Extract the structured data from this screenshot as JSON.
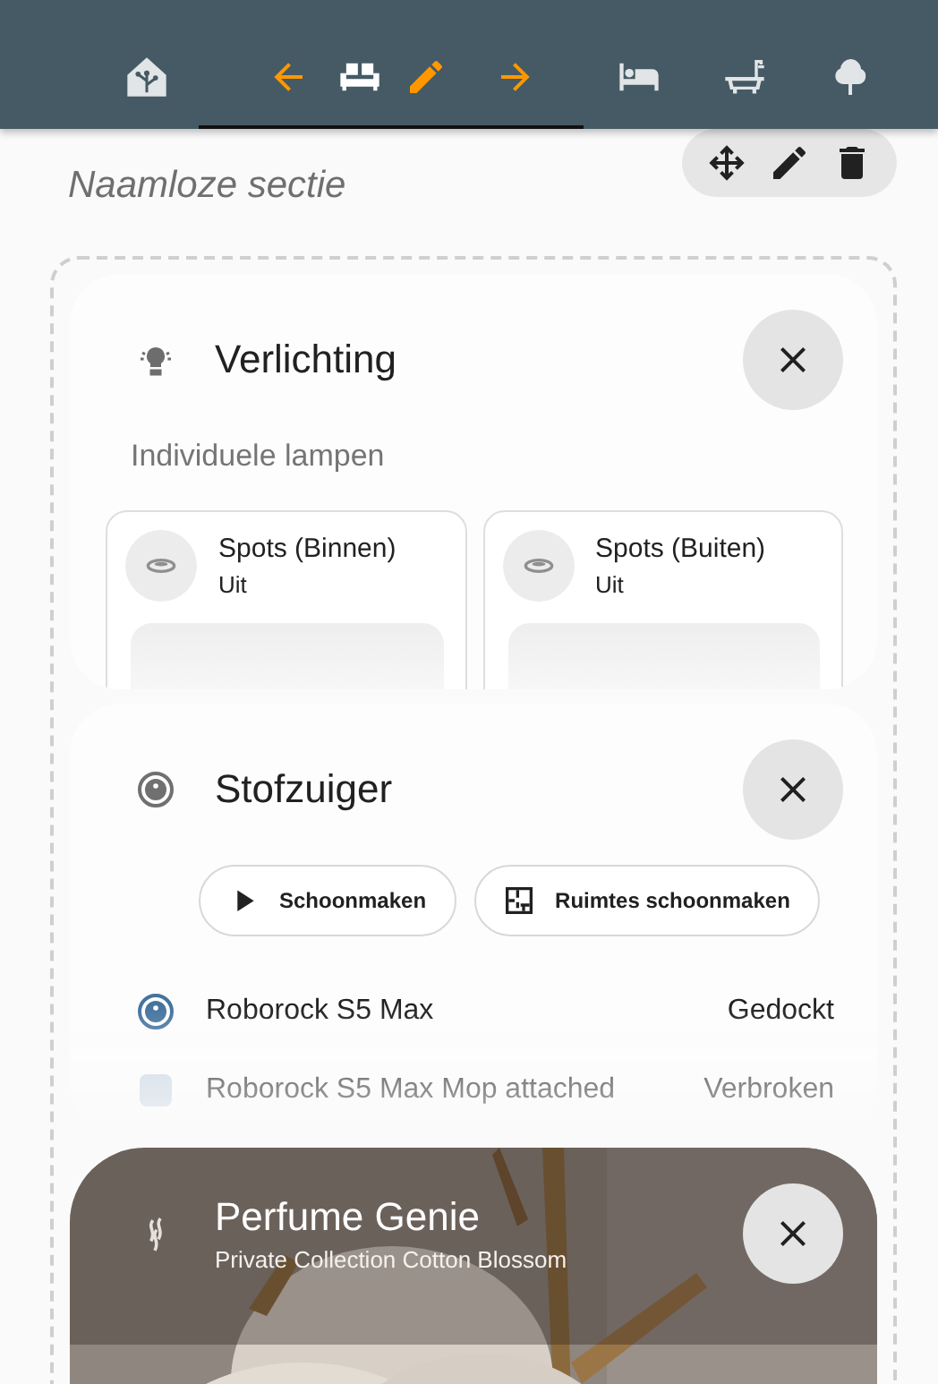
{
  "top_bar": {
    "tabs": [
      {
        "selected": false
      },
      {
        "selected": true,
        "editing": true
      },
      {
        "selected": false
      },
      {
        "selected": false
      },
      {
        "selected": false
      }
    ]
  },
  "section": {
    "title": "Naamloze sectie",
    "cards": [
      {
        "kind": "lights",
        "title": "Verlichting",
        "subtitle": "Individuele lampen",
        "tiles": [
          {
            "name": "Spots (Binnen)",
            "state": "Uit"
          },
          {
            "name": "Spots (Buiten)",
            "state": "Uit"
          }
        ]
      },
      {
        "kind": "vacuum",
        "title": "Stofzuiger",
        "buttons": [
          {
            "kind": "play",
            "label": "Schoonmaken"
          },
          {
            "kind": "rooms",
            "label": "Ruimtes schoonmaken"
          }
        ],
        "rows": [
          {
            "kind": "vacuum",
            "name": "Roborock S5 Max",
            "state": "Gedockt"
          },
          {
            "kind": "sensor",
            "name": "Roborock S5 Max Mop attached",
            "state": "Verbroken"
          }
        ]
      },
      {
        "kind": "media",
        "title": "Perfume Genie",
        "subtitle": "Private Collection Cotton Blossom"
      }
    ]
  }
}
